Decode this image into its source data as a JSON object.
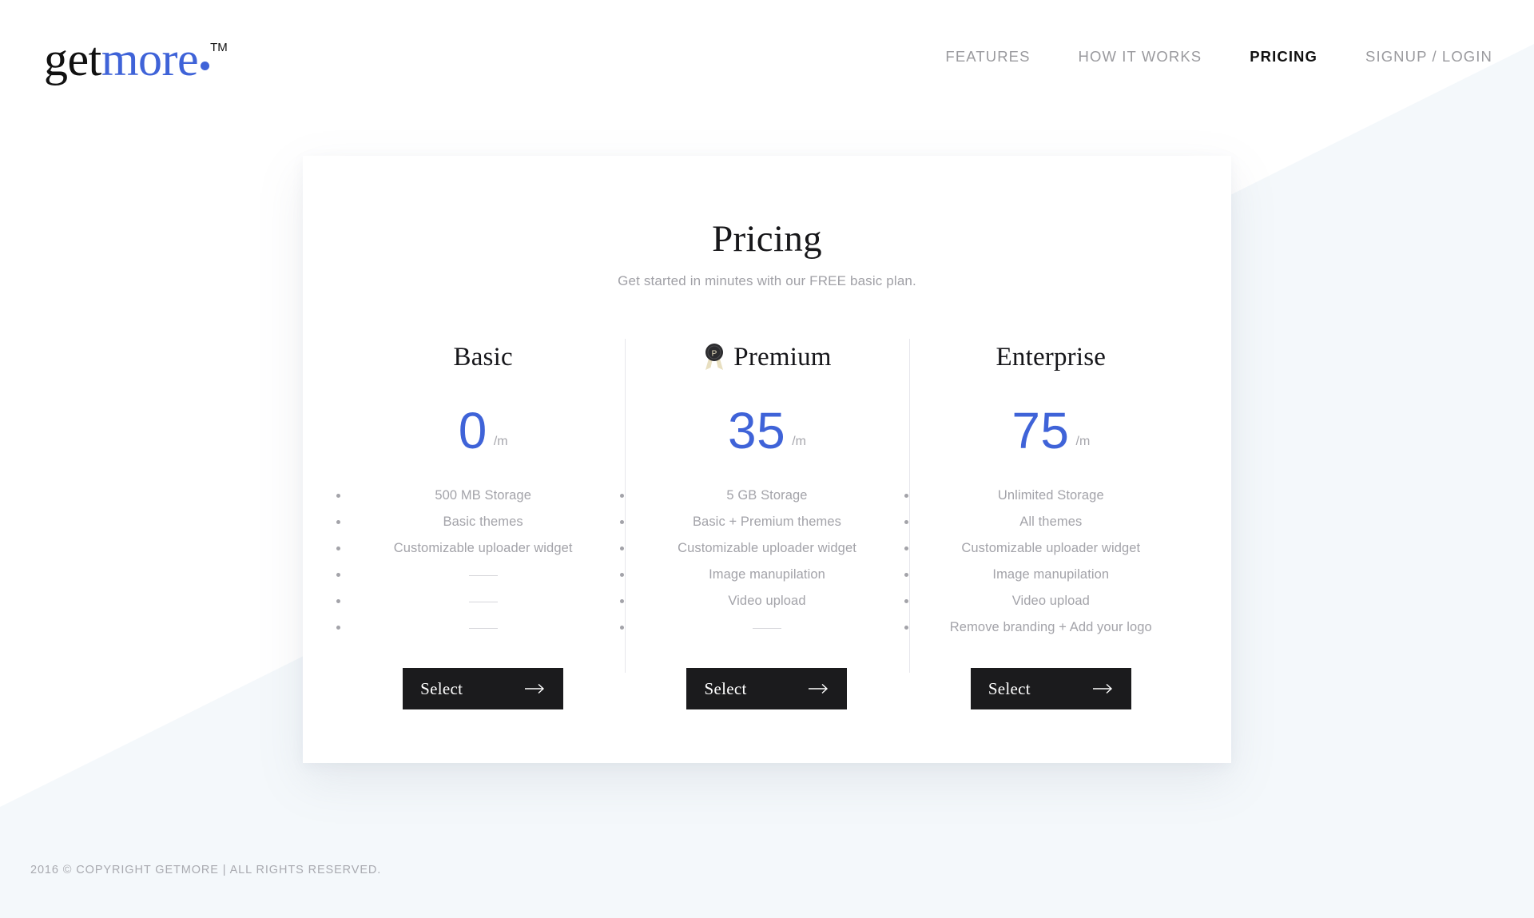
{
  "brand": {
    "logo_primary": "get",
    "logo_accent": "more",
    "trademark": "TM",
    "accent_color": "#3f63d8",
    "dot_icon": "dot-icon"
  },
  "nav": {
    "items": [
      {
        "label": "FEATURES",
        "active": false
      },
      {
        "label": "HOW IT WORKS",
        "active": false
      },
      {
        "label": "PRICING",
        "active": true
      },
      {
        "label": "SIGNUP / LOGIN",
        "active": false
      }
    ]
  },
  "card": {
    "title": "Pricing",
    "subtitle": "Get started in minutes with our FREE basic plan."
  },
  "plans": [
    {
      "name": "Basic",
      "badge": null,
      "price": "0",
      "period": "/m",
      "features": [
        "500 MB Storage",
        "Basic themes",
        "Customizable uploader widget"
      ],
      "empty_slots": 3,
      "cta_label": "Select"
    },
    {
      "name": "Premium",
      "badge": "premium-badge-icon",
      "badge_letter": "P",
      "price": "35",
      "period": "/m",
      "features": [
        "5 GB Storage",
        "Basic + Premium themes",
        "Customizable uploader widget",
        "Image manupilation",
        "Video upload"
      ],
      "empty_slots": 1,
      "cta_label": "Select"
    },
    {
      "name": "Enterprise",
      "badge": null,
      "price": "75",
      "period": "/m",
      "features": [
        "Unlimited Storage",
        "All themes",
        "Customizable uploader widget",
        "Image manupilation",
        "Video upload",
        "Remove branding + Add your logo"
      ],
      "empty_slots": 0,
      "cta_label": "Select"
    }
  ],
  "footer": {
    "copyright": "2016 © COPYRIGHT GETMORE | ALL RIGHTS RESERVED."
  },
  "theme": {
    "price_blue": "#3f63d8",
    "button_dark": "#1b1b1d",
    "wedge_blue": "#f4f8fb",
    "muted_text": "#a3a3a9",
    "badge_dark": "#2b2b2e",
    "badge_cream": "#e8dfc0"
  }
}
